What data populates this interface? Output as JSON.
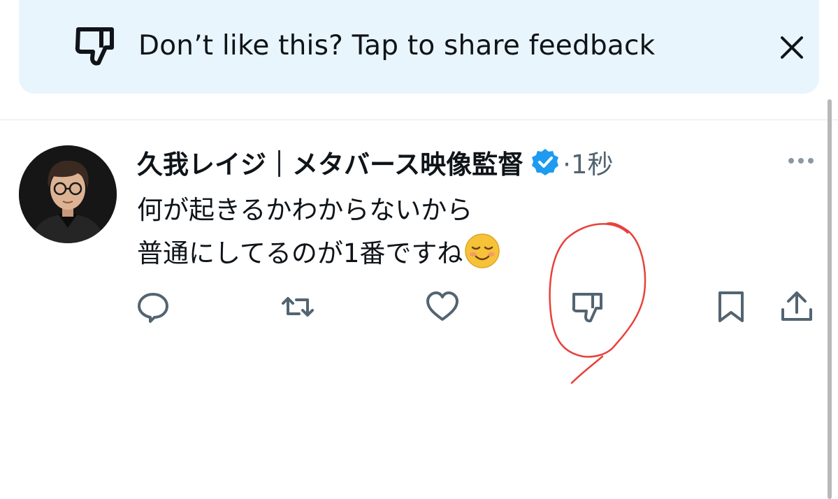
{
  "banner": {
    "icon": "thumbs-down-icon",
    "text": "Don’t like this? Tap to share feedback",
    "close_icon": "close-icon",
    "background": "#e9f5fc"
  },
  "tweet": {
    "avatar": "avatar",
    "author_name": "久我レイジ｜メタバース映像監督",
    "verified_icon": "verified-badge-icon",
    "timestamp": "·1秒",
    "more_icon": "more-icon",
    "text_lines": [
      "何が起きるかわからないから",
      "普通にしてるのが1番ですね"
    ],
    "emoji": "smiling-face-emoji",
    "actions": [
      {
        "name": "reply",
        "icon": "reply-icon"
      },
      {
        "name": "retweet",
        "icon": "retweet-icon"
      },
      {
        "name": "like",
        "icon": "heart-icon"
      },
      {
        "name": "downvote",
        "icon": "thumbs-down-icon"
      },
      {
        "name": "bookmark",
        "icon": "bookmark-icon"
      },
      {
        "name": "share",
        "icon": "share-icon"
      }
    ]
  },
  "colors": {
    "text_primary": "#0f1419",
    "text_secondary": "#536471",
    "verified_blue": "#1d9bf0",
    "annotation_red": "#e8413a"
  }
}
